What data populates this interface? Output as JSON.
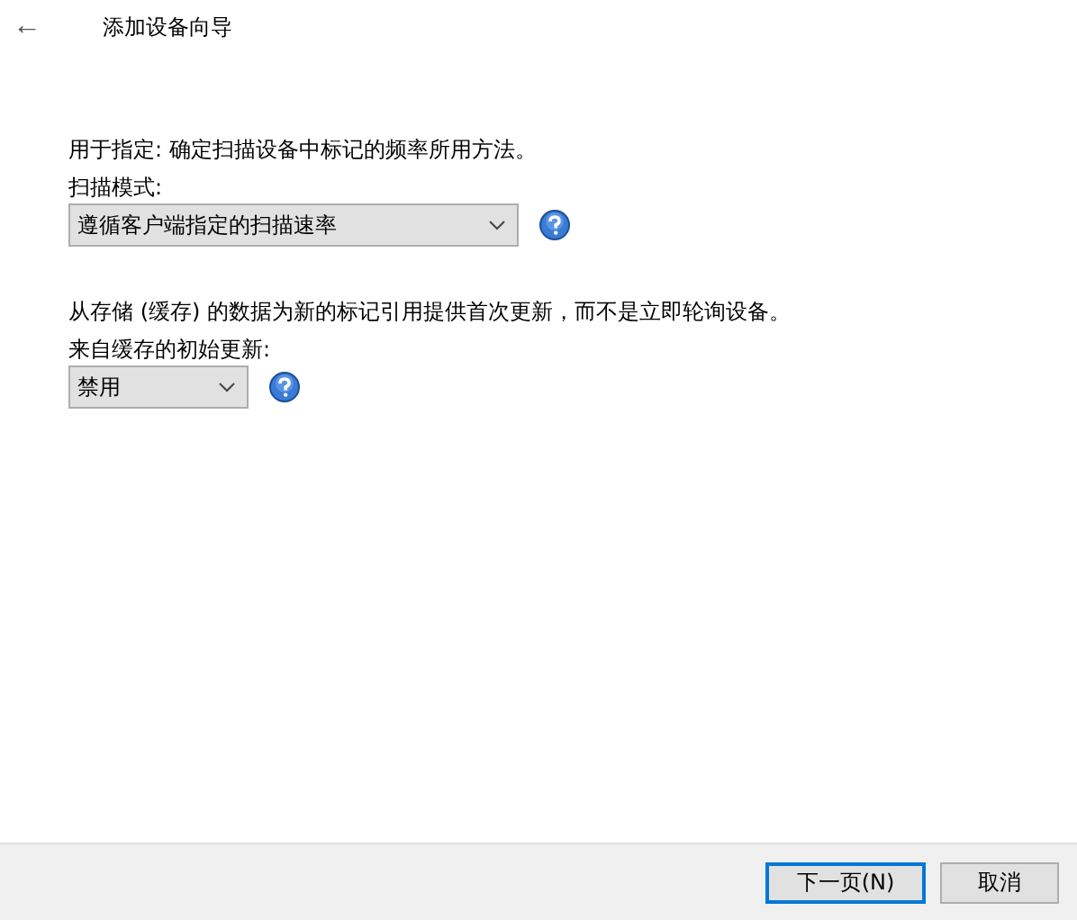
{
  "window": {
    "title": "添加设备向导",
    "back": "←"
  },
  "sections": [
    {
      "description": "用于指定: 确定扫描设备中标记的频率所用方法。",
      "label": "扫描模式:",
      "value": "遵循客户端指定的扫描速率",
      "kind": "wide"
    },
    {
      "description": "从存储 (缓存) 的数据为新的标记引用提供首次更新，而不是立即轮询设备。",
      "label": "来自缓存的初始更新:",
      "value": "禁用",
      "kind": "narrow"
    }
  ],
  "buttons": [
    {
      "label": "下一页(N)",
      "focused": true
    },
    {
      "label": "取消",
      "focused": false
    }
  ]
}
